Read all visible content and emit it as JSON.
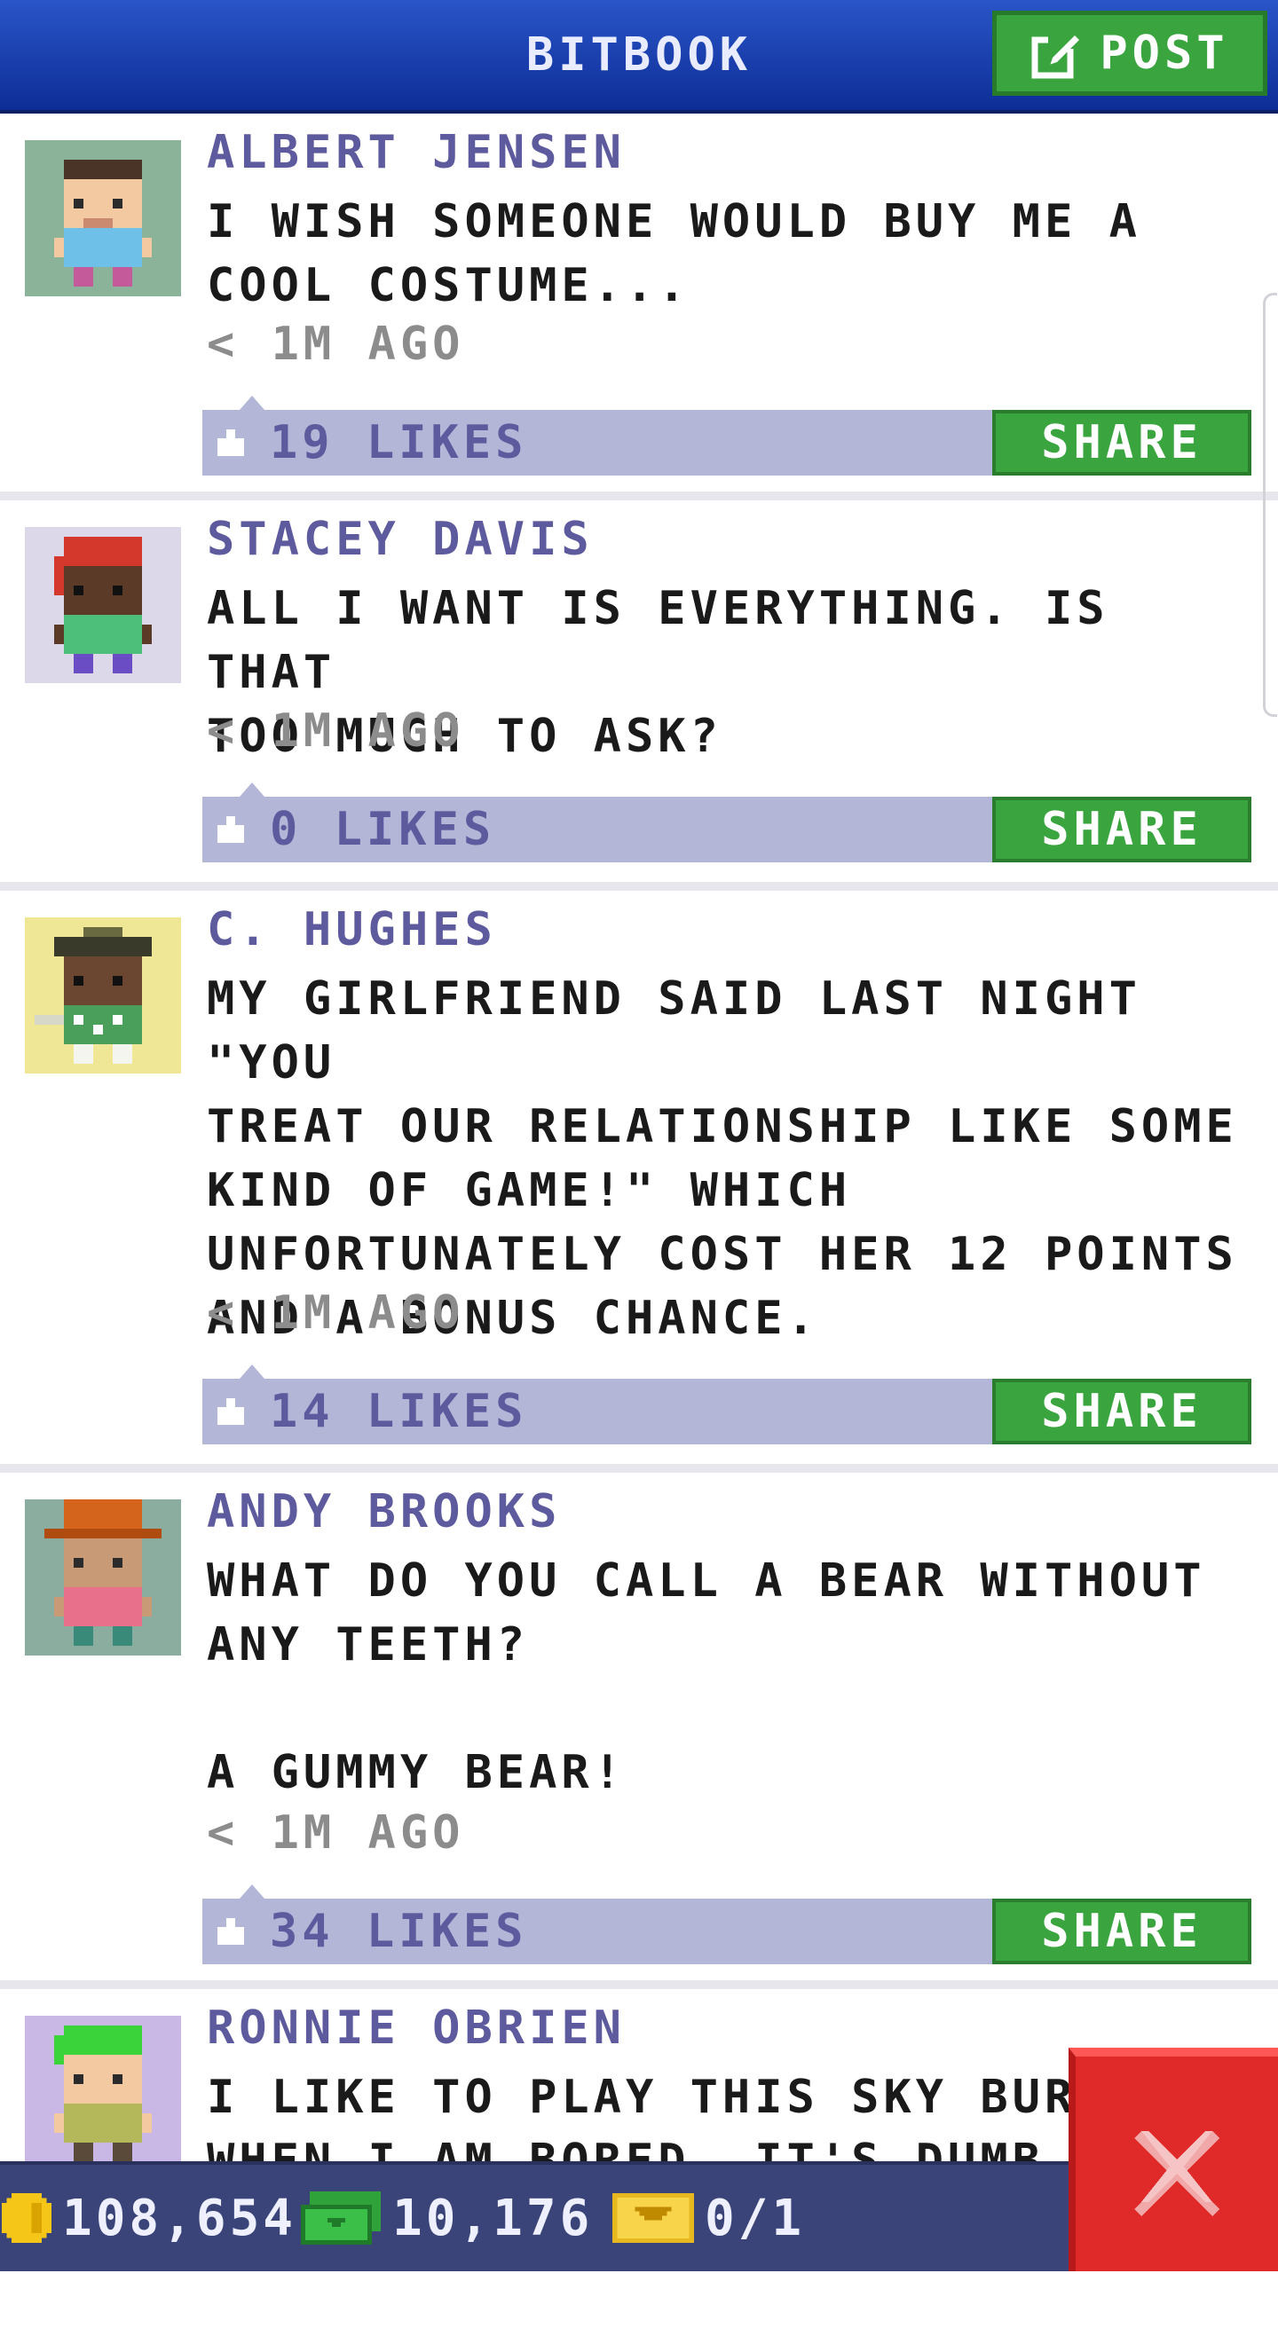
{
  "header": {
    "title": "BITBOOK",
    "post_label": "POST"
  },
  "posts": [
    {
      "author": "ALBERT JENSEN",
      "message": "I WISH SOMEONE WOULD BUY ME A\nCOOL COSTUME...",
      "time": "< 1M AGO",
      "likes": "19 LIKES",
      "share_label": "SHARE",
      "avatar_bg": "#8ab399"
    },
    {
      "author": "STACEY DAVIS",
      "message": "ALL I WANT IS EVERYTHING. IS THAT\nTOO MUCH TO ASK?",
      "time": "< 1M AGO",
      "likes": "0 LIKES",
      "share_label": "SHARE",
      "avatar_bg": "#dcd8ea"
    },
    {
      "author": "C. HUGHES",
      "message": "MY GIRLFRIEND SAID LAST NIGHT \"YOU\nTREAT OUR RELATIONSHIP LIKE SOME\nKIND OF GAME!\" WHICH\nUNFORTUNATELY COST HER 12 POINTS\nAND A BONUS CHANCE.",
      "time": "< 1M AGO",
      "likes": "14 LIKES",
      "share_label": "SHARE",
      "avatar_bg": "#efe795"
    },
    {
      "author": "ANDY BROOKS",
      "message": "WHAT DO YOU CALL A BEAR WITHOUT\nANY TEETH?\n\nA GUMMY BEAR!",
      "time": "< 1M AGO",
      "likes": "34 LIKES",
      "share_label": "SHARE",
      "avatar_bg": "#8aada0"
    },
    {
      "author": "RONNIE OBRIEN",
      "message": "I LIKE TO PLAY THIS SKY BURGER\nWHEN I AM BORED. IT'S DUMB BUT",
      "avatar_bg": "#c9b8e6"
    }
  ],
  "status_bar": {
    "coins": "108,654",
    "bux": "10,176",
    "tickets": "0/1"
  },
  "colors": {
    "header": "#1e45b8",
    "accent_green": "#3aa43e",
    "author": "#5d5a9e",
    "likes_bar": "#b4b6d8",
    "close": "#e02a2a"
  },
  "icons": [
    "edit-icon",
    "like-icon",
    "coin-icon",
    "bux-icon",
    "ticket-icon",
    "close-icon"
  ]
}
